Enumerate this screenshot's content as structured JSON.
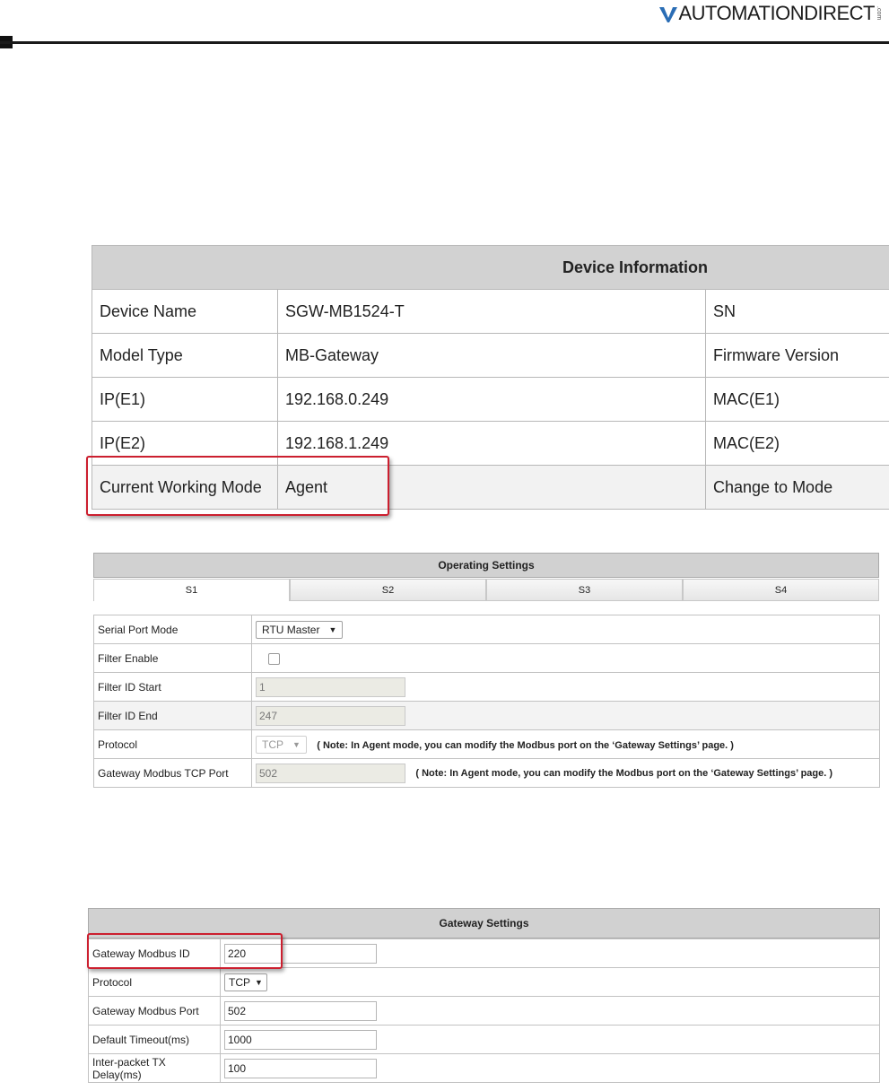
{
  "brand": {
    "logo_text": "AUTOMATIONDIRECT",
    "logo_suffix": ".com"
  },
  "device_information": {
    "title": "Device Information",
    "rows": [
      {
        "label": "Device Name",
        "value": "SGW-MB1524-T",
        "label2": "SN"
      },
      {
        "label": "Model Type",
        "value": "MB-Gateway",
        "label2": "Firmware Version"
      },
      {
        "label": "IP(E1)",
        "value": "192.168.0.249",
        "label2": "MAC(E1)"
      },
      {
        "label": "IP(E2)",
        "value": "192.168.1.249",
        "label2": "MAC(E2)"
      },
      {
        "label": "Current Working Mode",
        "value": "Agent",
        "label2": "Change to Mode"
      }
    ]
  },
  "operating_settings": {
    "title": "Operating Settings",
    "tabs": [
      "S1",
      "S2",
      "S3",
      "S4"
    ],
    "serial_port_mode": {
      "label": "Serial Port Mode",
      "value": "RTU Master"
    },
    "filter_enable": {
      "label": "Filter Enable",
      "checked": false
    },
    "filter_id_start": {
      "label": "Filter ID Start",
      "value": "1"
    },
    "filter_id_end": {
      "label": "Filter ID End",
      "value": "247"
    },
    "protocol": {
      "label": "Protocol",
      "value": "TCP",
      "note": "( Note: In Agent mode, you can modify the Modbus port on the ‘Gateway Settings’ page. )"
    },
    "gateway_modbus_tcp_port": {
      "label": "Gateway Modbus TCP Port",
      "value": "502",
      "note": "( Note: In Agent mode, you can modify the Modbus port on the ‘Gateway Settings’ page. )"
    }
  },
  "gateway_settings": {
    "title": "Gateway Settings",
    "modbus_id": {
      "label": "Gateway Modbus ID",
      "value": "220"
    },
    "protocol": {
      "label": "Protocol",
      "value": "TCP"
    },
    "modbus_port": {
      "label": "Gateway Modbus Port",
      "value": "502"
    },
    "default_timeout": {
      "label": "Default Timeout(ms)",
      "value": "1000"
    },
    "tx_delay": {
      "label": "Inter-packet TX Delay(ms)",
      "value": "100"
    }
  },
  "colors": {
    "highlight": "#cc1f2f",
    "header_gray": "#d1d1d1",
    "logo_blue": "#2a6db5"
  }
}
